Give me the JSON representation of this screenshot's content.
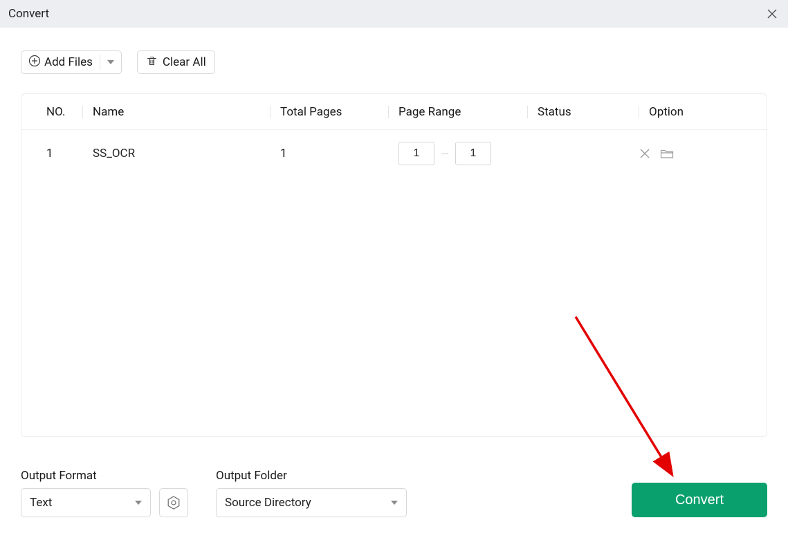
{
  "header": {
    "title": "Convert"
  },
  "toolbar": {
    "add_files_label": "Add Files",
    "clear_all_label": "Clear All"
  },
  "table": {
    "columns": {
      "no": "NO.",
      "name": "Name",
      "pages": "Total Pages",
      "range": "Page Range",
      "status": "Status",
      "option": "Option"
    },
    "rows": [
      {
        "no": "1",
        "name": "SS_OCR",
        "total_pages": "1",
        "range_from": "1",
        "range_to": "1",
        "status": ""
      }
    ]
  },
  "output_format": {
    "label": "Output Format",
    "value": "Text"
  },
  "output_folder": {
    "label": "Output Folder",
    "value": "Source Directory"
  },
  "convert_label": "Convert"
}
